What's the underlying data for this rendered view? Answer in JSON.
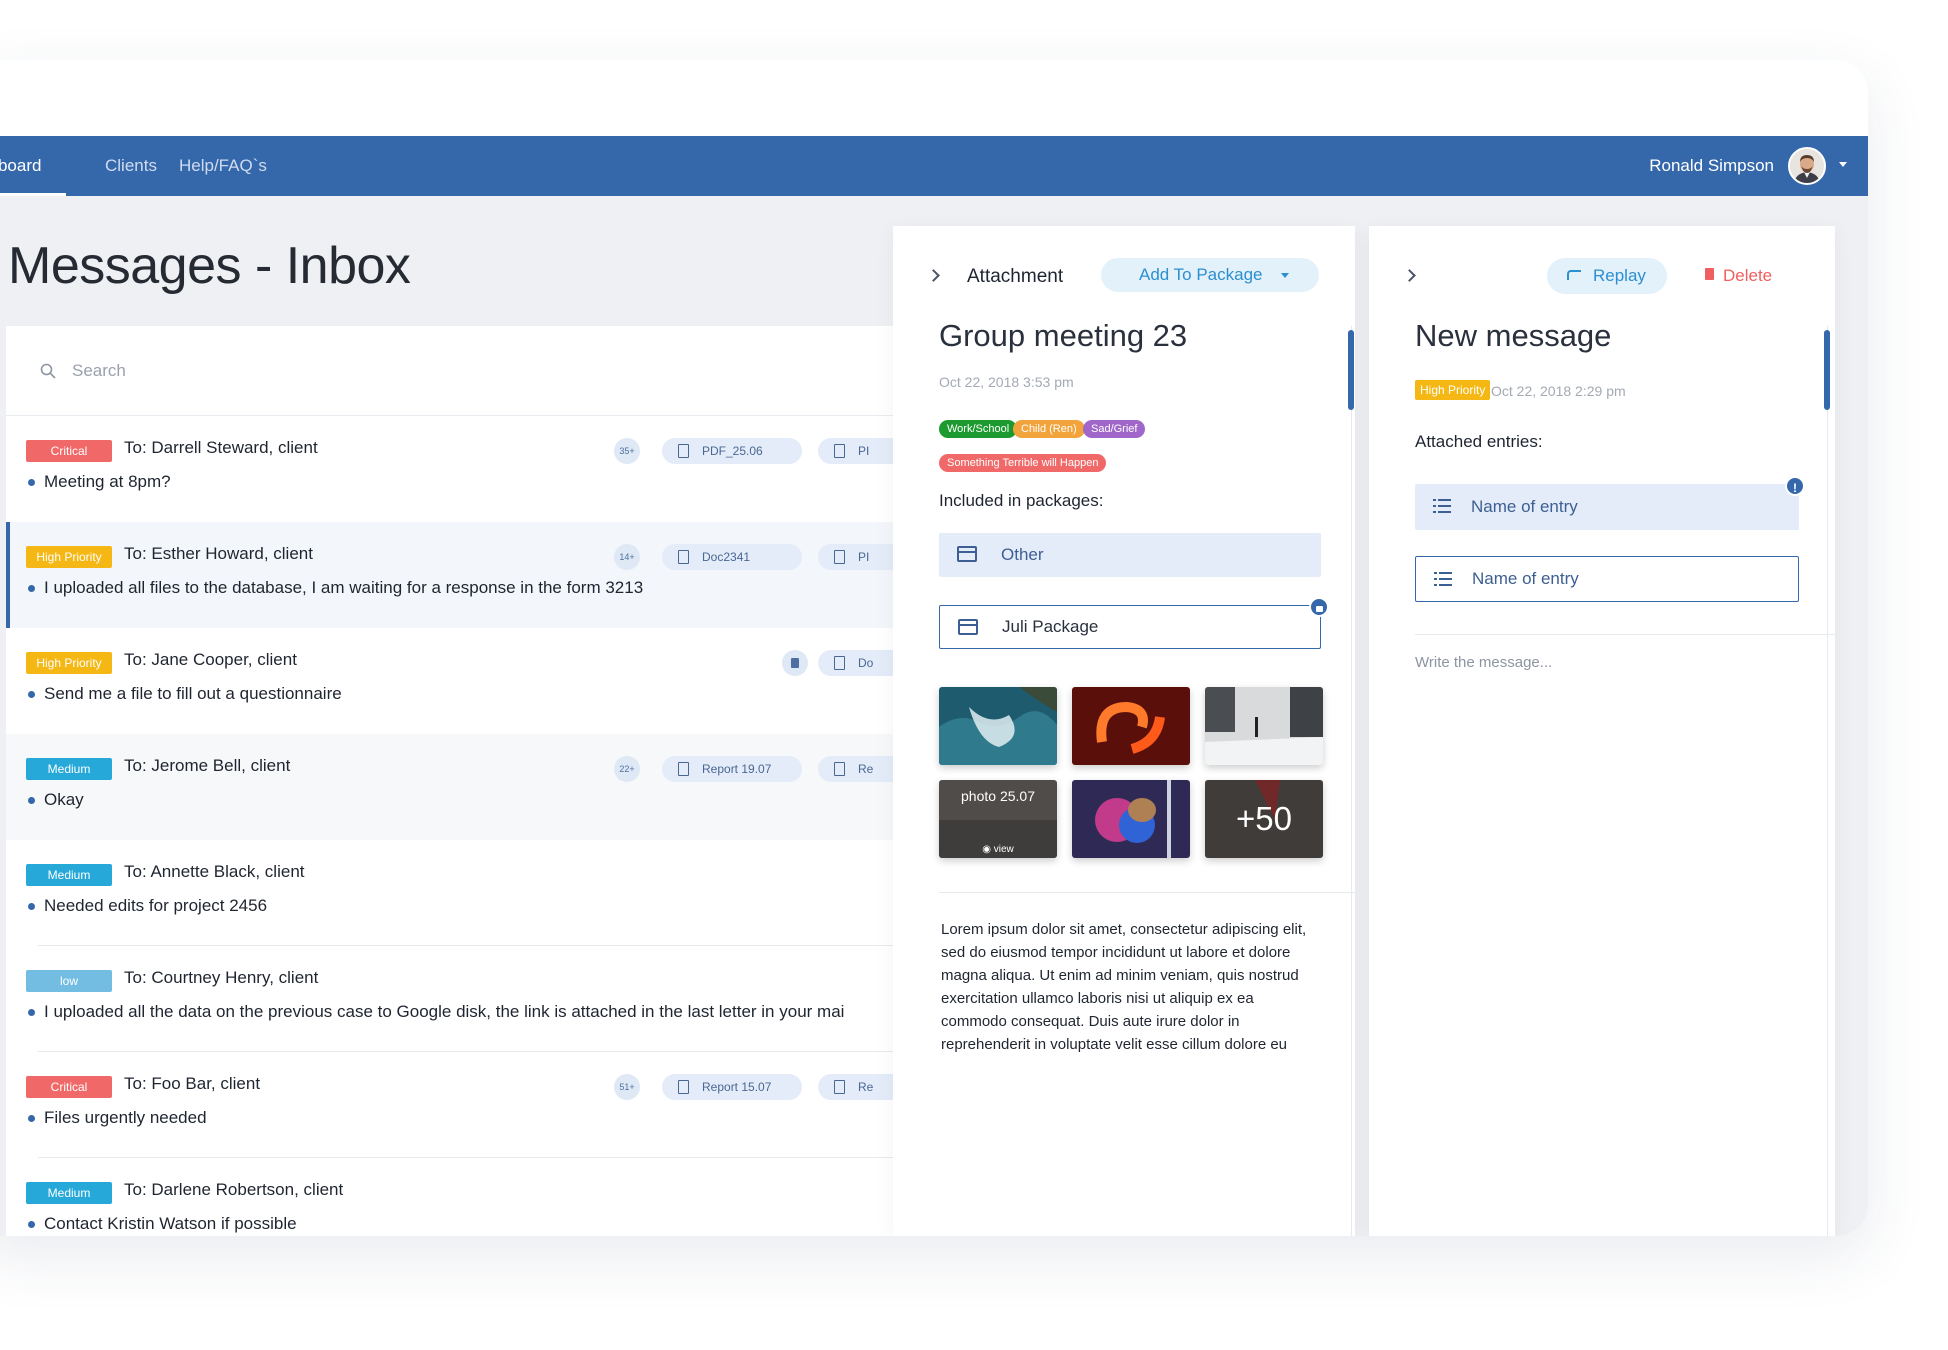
{
  "nav": {
    "tabs": [
      {
        "label": "shboard"
      },
      {
        "label": "Clients"
      },
      {
        "label": "Help/FAQ`s"
      }
    ],
    "user_name": "Ronald Simpson",
    "accent_color": "#3567ab"
  },
  "page_title": "Messages - Inbox",
  "search": {
    "placeholder": "Search"
  },
  "messages": [
    {
      "priority": "Critical",
      "to": "To: Darrell Steward, client",
      "text": "Meeting at 8pm?",
      "count": "35+",
      "file1": "PDF_25.06",
      "file2": "PI"
    },
    {
      "priority": "High Priority",
      "to": "To: Esther Howard, client",
      "text": "I uploaded all files to the database, I am waiting for a response in the form 3213",
      "count": "14+",
      "file1": "Doc2341",
      "file2": "PI"
    },
    {
      "priority": "High Priority",
      "to": "To: Jane Cooper, client",
      "text": "Send me a file to fill out a questionnaire",
      "file2": "Do"
    },
    {
      "priority": "Medium",
      "to": "To: Jerome Bell, client",
      "text": "Okay",
      "count": "22+",
      "file1": "Report 19.07",
      "file2": "Re"
    },
    {
      "priority": "Medium",
      "to": "To: Annette Black, client",
      "text": "Needed edits for project 2456"
    },
    {
      "priority": "low",
      "to": "To: Courtney Henry, client",
      "text": "I uploaded all the data on the previous case to Google disk, the link is attached in the last letter in your mai"
    },
    {
      "priority": "Critical",
      "to": "To: Foo Bar, client",
      "text": "Files urgently needed",
      "count": "51+",
      "file1": "Report 15.07",
      "file2": "Re"
    },
    {
      "priority": "Medium",
      "to": "To: Darlene Robertson, client",
      "text": "Contact Kristin Watson if possible"
    }
  ],
  "detail": {
    "attachment_label": "Attachment",
    "add_to_package": "Add To Package",
    "title": "Group meeting 23",
    "date": "Oct 22, 2018 3:53 pm",
    "tags": [
      {
        "label": "Work/School",
        "color": "#1d9a2f"
      },
      {
        "label": "Child (Ren)",
        "color": "#f2a33b"
      },
      {
        "label": "Sad/Grief",
        "color": "#a066c9"
      },
      {
        "label": "Something Terrible will Happen",
        "color": "#f06868"
      }
    ],
    "included_label": "Included in packages:",
    "packages": [
      "Other",
      "Juli Package"
    ],
    "photos": {
      "caption": "photo 25.07",
      "view": "view",
      "more": "+50"
    },
    "body": "Lorem ipsum dolor sit amet, consectetur adipiscing elit, sed do eiusmod tempor incididunt ut labore et dolore magna aliqua. Ut enim ad minim veniam, quis nostrud exercitation ullamco laboris nisi ut aliquip ex ea commodo consequat. Duis aute irure dolor in reprehenderit in voluptate velit esse cillum dolore eu fugiat null:"
  },
  "reply": {
    "replay_label": "Replay",
    "delete_label": "Delete",
    "title": "New message",
    "priority": "High Priority",
    "date": "Oct 22, 2018 2:29 pm",
    "attached_label": "Attached entries:",
    "entries": [
      "Name of entry",
      "Name of entry"
    ],
    "warn_icon": "!",
    "write_placeholder": "Write the message..."
  }
}
